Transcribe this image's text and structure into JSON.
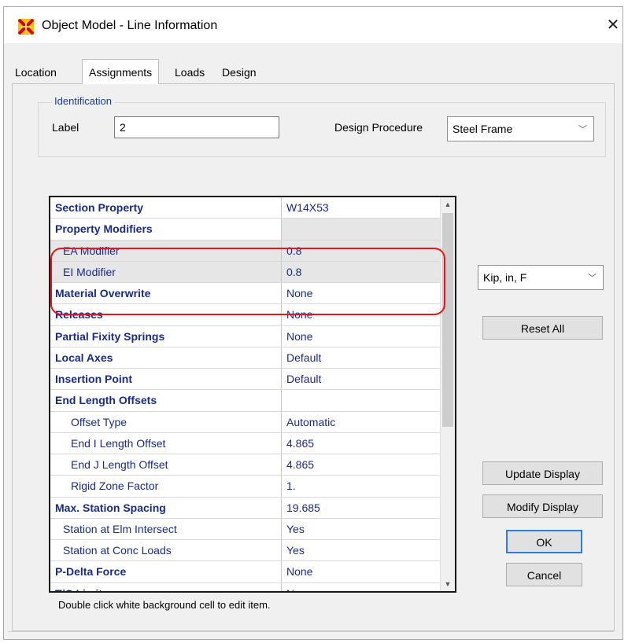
{
  "window": {
    "title": "Object Model - Line Information",
    "close_symbol": "✕"
  },
  "tabs": [
    {
      "label": "Location",
      "active": false
    },
    {
      "label": "Assignments",
      "active": true
    },
    {
      "label": "Loads",
      "active": false
    },
    {
      "label": "Design",
      "active": false
    }
  ],
  "identification": {
    "legend": "Identification",
    "label_caption": "Label",
    "label_value": "2",
    "design_caption": "Design Procedure",
    "design_value": "Steel Frame"
  },
  "grid": {
    "rows": [
      {
        "name": "Section Property",
        "value": "W14X53",
        "style": "bold",
        "indent": 0,
        "grey": false,
        "grey_value": false
      },
      {
        "name": "Property Modifiers",
        "value": "",
        "style": "bold",
        "indent": 0,
        "grey": false,
        "grey_value": true
      },
      {
        "name": "EA Modifier",
        "value": "0.8",
        "style": "norm",
        "indent": 1,
        "grey": true,
        "grey_value": true
      },
      {
        "name": "EI Modifier",
        "value": "0.8",
        "style": "norm",
        "indent": 1,
        "grey": true,
        "grey_value": true
      },
      {
        "name": "Material Overwrite",
        "value": "None",
        "style": "bold",
        "indent": 0,
        "grey": false,
        "grey_value": false
      },
      {
        "name": "Releases",
        "value": "None",
        "style": "bold",
        "indent": 0,
        "grey": false,
        "grey_value": false
      },
      {
        "name": "Partial Fixity Springs",
        "value": "None",
        "style": "bold",
        "indent": 0,
        "grey": false,
        "grey_value": false
      },
      {
        "name": "Local Axes",
        "value": "Default",
        "style": "bold",
        "indent": 0,
        "grey": false,
        "grey_value": false
      },
      {
        "name": "Insertion Point",
        "value": "Default",
        "style": "bold",
        "indent": 0,
        "grey": false,
        "grey_value": false
      },
      {
        "name": "End Length Offsets",
        "value": "",
        "style": "bold",
        "indent": 0,
        "grey": false,
        "grey_value": false
      },
      {
        "name": "Offset Type",
        "value": "Automatic",
        "style": "norm",
        "indent": 2,
        "grey": false,
        "grey_value": false
      },
      {
        "name": "End I Length Offset",
        "value": "4.865",
        "style": "norm",
        "indent": 2,
        "grey": false,
        "grey_value": false
      },
      {
        "name": "End J Length Offset",
        "value": "4.865",
        "style": "norm",
        "indent": 2,
        "grey": false,
        "grey_value": false
      },
      {
        "name": "Rigid Zone Factor",
        "value": "1.",
        "style": "norm",
        "indent": 2,
        "grey": false,
        "grey_value": false
      },
      {
        "name": "Max. Station Spacing",
        "value": "19.685",
        "style": "bold",
        "indent": 0,
        "grey": false,
        "grey_value": false
      },
      {
        "name": "Station at Elm Intersect",
        "value": "Yes",
        "style": "norm",
        "indent": 1,
        "grey": false,
        "grey_value": false
      },
      {
        "name": "Station at Conc Loads",
        "value": "Yes",
        "style": "norm",
        "indent": 1,
        "grey": false,
        "grey_value": false
      },
      {
        "name": "P-Delta Force",
        "value": "None",
        "style": "bold",
        "indent": 0,
        "grey": false,
        "grey_value": false
      },
      {
        "name": "T/C Limits",
        "value": "None",
        "style": "bold",
        "indent": 0,
        "grey": false,
        "grey_value": false
      }
    ],
    "scroll_up": "▲",
    "scroll_down": "▼",
    "hint": "Double click white background cell to edit item."
  },
  "units": {
    "value": "Kip, in, F"
  },
  "buttons": {
    "reset_all": "Reset All",
    "update_display": "Update Display",
    "modify_display": "Modify Display",
    "ok": "OK",
    "cancel": "Cancel"
  },
  "combo_arrow": "﹀",
  "highlight_color": "#e8141e",
  "accent_color": "#2b7fd6"
}
